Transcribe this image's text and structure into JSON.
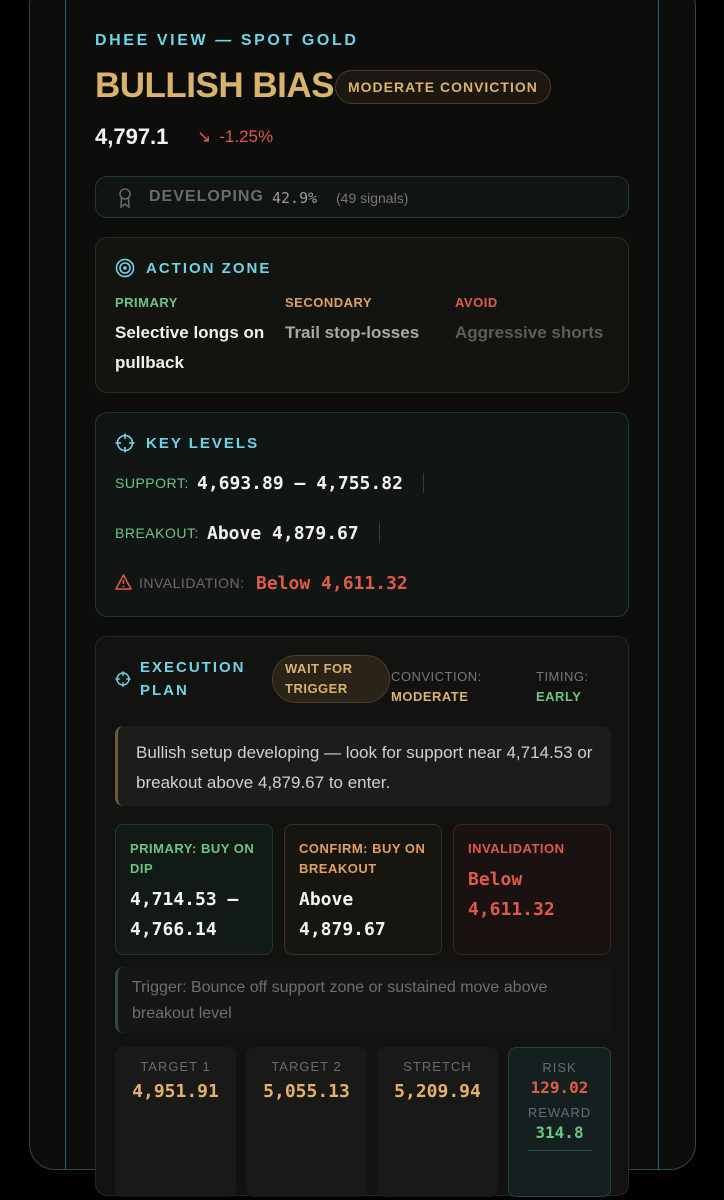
{
  "header": {
    "eyebrow": "DHEE VIEW — SPOT GOLD",
    "bias": "BULLISH BIAS",
    "conviction_pill": "MODERATE CONVICTION",
    "price": "4,797.1",
    "change": "-1.25%",
    "change_direction": "down"
  },
  "status": {
    "label": "DEVELOPING",
    "percent": "42.9%",
    "signals": "(49 signals)"
  },
  "action_zone": {
    "title": "ACTION ZONE",
    "primary_label": "PRIMARY",
    "primary_text": "Selective longs on pullback",
    "secondary_label": "SECONDARY",
    "secondary_text": "Trail stop-losses",
    "avoid_label": "AVOID",
    "avoid_text": "Aggressive shorts"
  },
  "key_levels": {
    "title": "KEY LEVELS",
    "support_label": "SUPPORT:",
    "support_value": "4,693.89 — 4,755.82",
    "breakout_label": "BREAKOUT:",
    "breakout_value": "Above 4,879.67",
    "invalidation_label": "INVALIDATION:",
    "invalidation_value": "Below 4,611.32"
  },
  "execution": {
    "title_line1": "EXECUTION",
    "title_line2": "PLAN",
    "wait_pill": "WAIT FOR TRIGGER",
    "conviction_label": "CONVICTION:",
    "conviction_value": "MODERATE",
    "timing_label": "TIMING:",
    "timing_value": "EARLY",
    "summary": "Bullish setup developing — look for support near 4,714.53 or breakout above 4,879.67 to enter.",
    "entries": [
      {
        "label": "PRIMARY: BUY ON DIP",
        "value": "4,714.53 — 4,766.14"
      },
      {
        "label": "CONFIRM: BUY ON BREAKOUT",
        "value": "Above 4,879.67"
      },
      {
        "label": "INVALIDATION",
        "value": "Below 4,611.32"
      }
    ],
    "trigger": "Trigger: Bounce off support zone or sustained move above breakout level",
    "targets": [
      {
        "label": "TARGET 1",
        "value": "4,951.91"
      },
      {
        "label": "TARGET 2",
        "value": "5,055.13"
      },
      {
        "label": "STRETCH",
        "value": "5,209.94"
      }
    ],
    "risk_label": "RISK",
    "risk_value": "129.02",
    "reward_label": "REWARD",
    "reward_value": "314.8"
  },
  "colors": {
    "accent_cyan": "#6fd4e6",
    "gold": "#d9b26c",
    "green": "#6cc486",
    "orange": "#e0a060",
    "red": "#e05a4a"
  }
}
